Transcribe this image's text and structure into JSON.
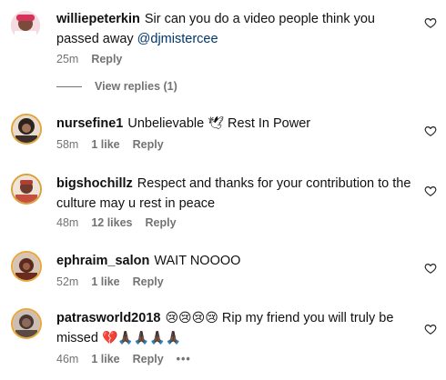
{
  "comments": [
    {
      "username": "williepeterkin",
      "text": "Sir can you do a video people think you passed away",
      "mention": "@djmistercee",
      "time": "25m",
      "reply": "Reply",
      "avatar_color": "#d6335a"
    },
    {
      "username": "nursefine1",
      "text": "Unbelievable",
      "emoji": "🕊",
      "text_after": "Rest In Power",
      "time": "58m",
      "likes": "1 like",
      "reply": "Reply",
      "avatar_color": "#3a2e2a"
    },
    {
      "username": "bigshochillz",
      "text": "Respect and thanks for your contribution to the culture may u rest in peace",
      "time": "48m",
      "likes": "12 likes",
      "reply": "Reply",
      "avatar_color": "#b04035"
    },
    {
      "username": "ephraim_salon",
      "text": "WAIT NOOOO",
      "time": "52m",
      "likes": "1 like",
      "reply": "Reply",
      "avatar_color": "#6b2a1e"
    },
    {
      "username": "patrasworld2018",
      "emoji": "😢😢😢😢",
      "text": "Rip my friend you will truly be missed",
      "emoji_after": "💔🙏🏿🙏🏿🙏🏿🙏🏿",
      "time": "46m",
      "likes": "1 like",
      "reply": "Reply",
      "more": "•••",
      "avatar_color": "#5a4a44"
    }
  ],
  "view_replies": "View replies (1)"
}
